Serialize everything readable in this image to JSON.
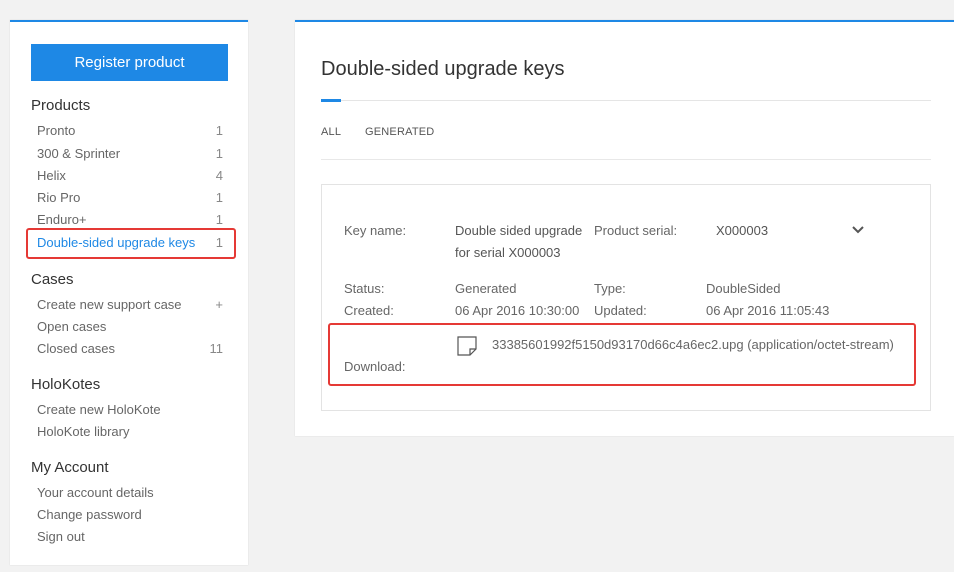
{
  "sidebar": {
    "register_label": "Register product",
    "sections": [
      {
        "title": "Products",
        "items": [
          {
            "label": "Pronto",
            "count": "1"
          },
          {
            "label": "300 & Sprinter",
            "count": "1"
          },
          {
            "label": "Helix",
            "count": "4"
          },
          {
            "label": "Rio Pro",
            "count": "1"
          },
          {
            "label": "Enduro+",
            "count": "1"
          },
          {
            "label": "Double-sided upgrade keys",
            "count": "1",
            "active": true
          }
        ]
      },
      {
        "title": "Cases",
        "items": [
          {
            "label": "Create new support case",
            "count": "+"
          },
          {
            "label": "Open cases",
            "count": ""
          },
          {
            "label": "Closed cases",
            "count": "11"
          }
        ]
      },
      {
        "title": "HoloKotes",
        "items": [
          {
            "label": "Create new HoloKote",
            "count": ""
          },
          {
            "label": "HoloKote library",
            "count": ""
          }
        ]
      },
      {
        "title": "My Account",
        "items": [
          {
            "label": "Your account details",
            "count": ""
          },
          {
            "label": "Change password",
            "count": ""
          },
          {
            "label": "Sign out",
            "count": ""
          }
        ]
      }
    ]
  },
  "main": {
    "title": "Double-sided upgrade keys",
    "tabs": [
      "ALL",
      "GENERATED"
    ],
    "key": {
      "key_name_label": "Key name:",
      "key_name_line1": "Double sided upgrade",
      "key_name_line2": "for serial X000003",
      "serial_label": "Product serial:",
      "serial_value": "X000003",
      "status_label": "Status:",
      "status_value": "Generated",
      "type_label": "Type:",
      "type_value": "DoubleSided",
      "created_label": "Created:",
      "created_value": "06 Apr 2016 10:30:00",
      "updated_label": "Updated:",
      "updated_value": "06 Apr 2016 11:05:43",
      "download_label": "Download:",
      "download_file": "33385601992f5150d93170d66c4a6ec2.upg (application/octet-stream)"
    }
  },
  "colors": {
    "accent": "#1e88e5",
    "highlight": "#e53935"
  },
  "icons": {
    "expand": "chevron-down-icon",
    "file": "file-icon"
  }
}
